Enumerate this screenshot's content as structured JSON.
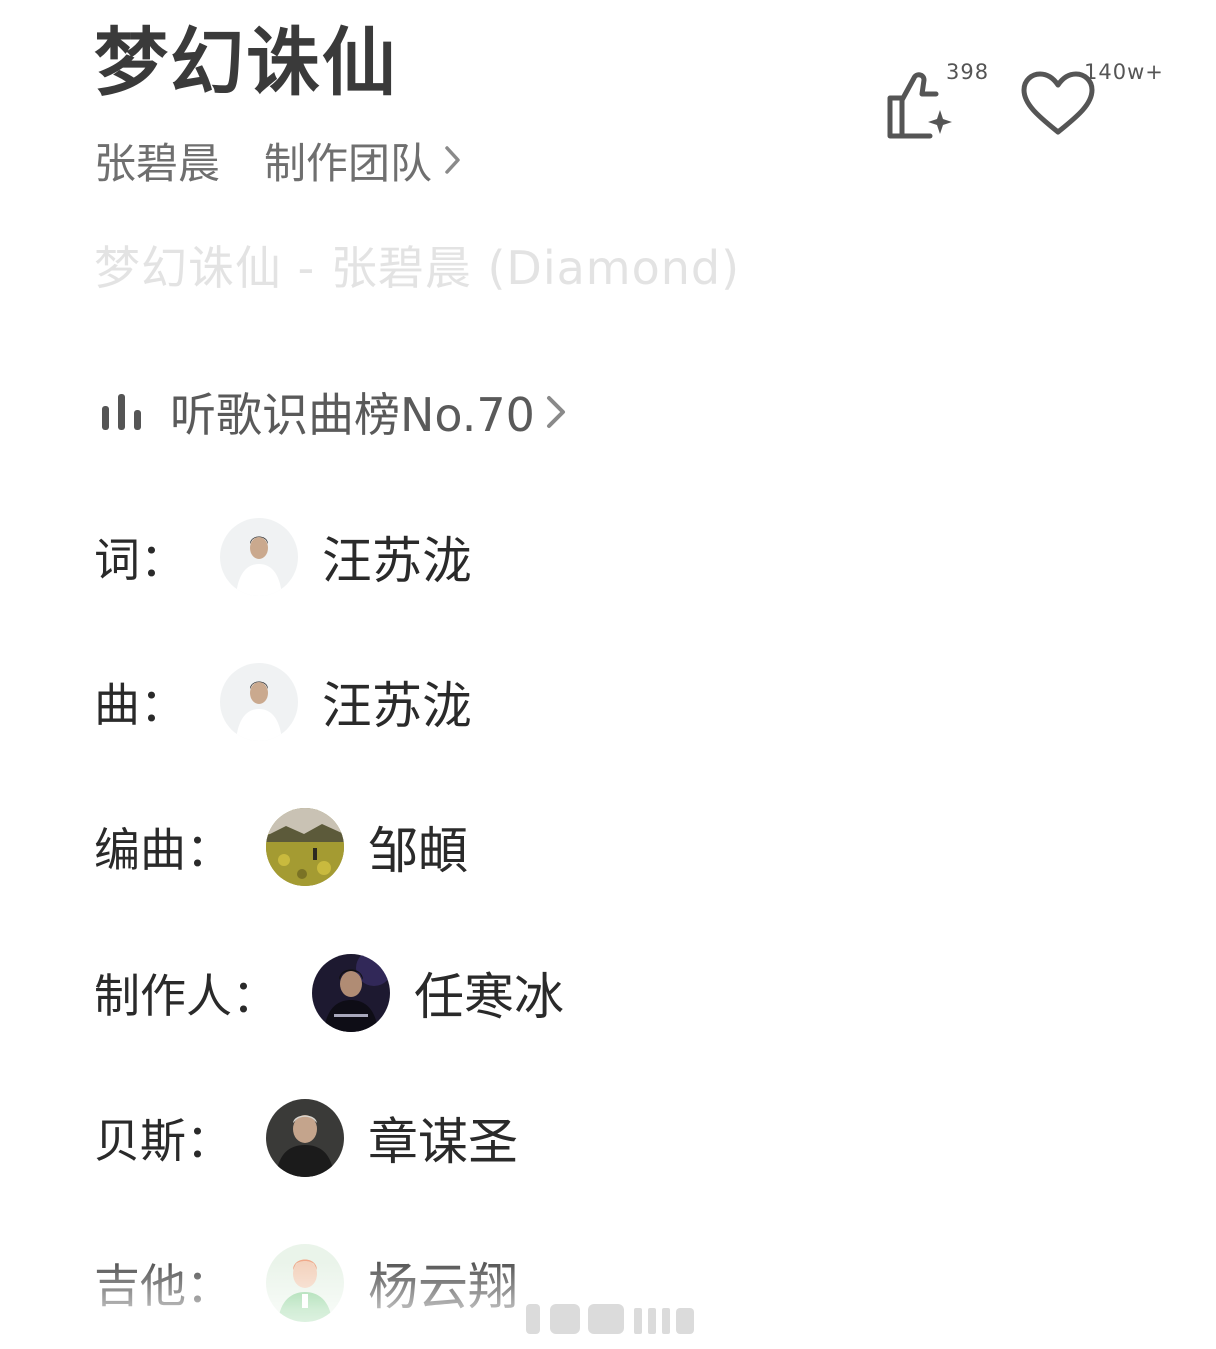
{
  "song": {
    "title": "梦幻诛仙",
    "artist": "张碧晨",
    "team_label": "制作团队",
    "version_line": "梦幻诛仙 - 张碧晨 (Diamond)"
  },
  "actions": {
    "like_count": "398",
    "favorite_count": "140w+"
  },
  "chart_rank": {
    "label": "听歌识曲榜No.70"
  },
  "credits": [
    {
      "role": "词：",
      "name": "汪苏泷",
      "avatar": "portrait-white-shirt"
    },
    {
      "role": "曲：",
      "name": "汪苏泷",
      "avatar": "portrait-white-shirt"
    },
    {
      "role": "编曲：",
      "name": "邹頔",
      "avatar": "landscape-field"
    },
    {
      "role": "制作人：",
      "name": "任寒冰",
      "avatar": "portrait-dark-purple"
    },
    {
      "role": "贝斯：",
      "name": "章谋圣",
      "avatar": "portrait-dark-gray"
    },
    {
      "role": "吉他：",
      "name": "杨云翔",
      "avatar": "default-avatar-green"
    }
  ],
  "colors": {
    "title": "#3a3a3a",
    "subtle": "#6f6f6f",
    "faint": "#e3e3e3",
    "text": "#2a2a2a"
  },
  "icons": {
    "like": "thumbs-up-sparkle-icon",
    "favorite": "heart-outline-icon",
    "chart": "bar-chart-icon",
    "chevron": "chevron-right-icon"
  }
}
